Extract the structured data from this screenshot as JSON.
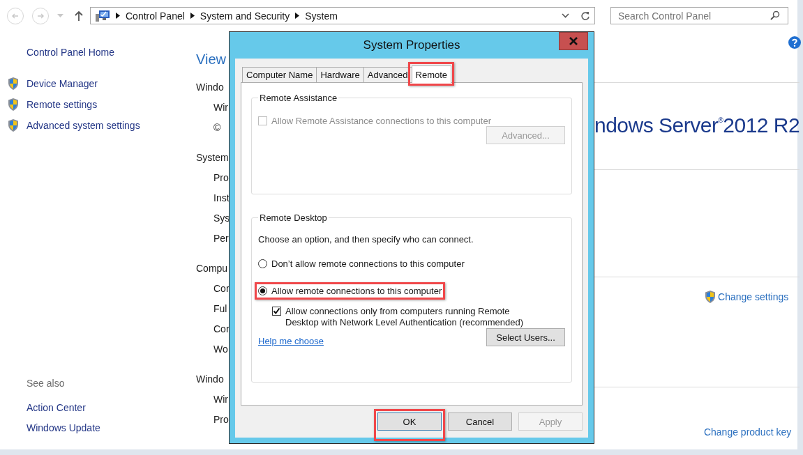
{
  "toolbar": {
    "breadcrumbs": [
      "Control Panel",
      "System and Security",
      "System"
    ],
    "search": {
      "placeholder": "Search Control Panel"
    }
  },
  "sidebar": {
    "items": [
      {
        "label": "Control Panel Home",
        "kind": "home"
      },
      {
        "label": "Device Manager",
        "kind": "shield"
      },
      {
        "label": "Remote settings",
        "kind": "shield"
      },
      {
        "label": "Advanced system settings",
        "kind": "shield"
      }
    ],
    "see_also": {
      "title": "See also",
      "items": [
        "Action Center",
        "Windows Update"
      ]
    }
  },
  "main": {
    "items": [
      {
        "text": "View",
        "kind": "title"
      },
      {
        "text": "Windo",
        "kind": "section"
      },
      {
        "text": "Wir",
        "kind": "item"
      },
      {
        "text": "©",
        "kind": "item"
      },
      {
        "text": "System",
        "kind": "section"
      },
      {
        "text": "Pro",
        "kind": "item"
      },
      {
        "text": "Inst",
        "kind": "item"
      },
      {
        "text": "Sys",
        "kind": "item"
      },
      {
        "text": "Per",
        "kind": "item"
      },
      {
        "text": "Compu",
        "kind": "section"
      },
      {
        "text": "Cor",
        "kind": "item"
      },
      {
        "text": "Ful",
        "kind": "item"
      },
      {
        "text": "Cor",
        "kind": "item"
      },
      {
        "text": "Wo",
        "kind": "item"
      },
      {
        "text": "Windo",
        "kind": "section"
      },
      {
        "text": "Wir",
        "kind": "item"
      },
      {
        "text": "Pro",
        "kind": "item"
      }
    ]
  },
  "right": {
    "logo": "ndows Server$^{®}$2012 R2",
    "change_settings": "Change settings",
    "change_product_key": "Change product key"
  },
  "dialog": {
    "title": "System Properties",
    "tabs": [
      {
        "label": "Computer Name",
        "selected": false,
        "highlighted": false
      },
      {
        "label": "Hardware",
        "selected": false,
        "highlighted": false
      },
      {
        "label": "Advanced",
        "selected": false,
        "highlighted": false
      },
      {
        "label": "Remote",
        "selected": true,
        "highlighted": true
      }
    ],
    "remote_assistance": {
      "title": "Remote Assistance",
      "checkbox": {
        "label": "Allow Remote Assistance connections to this computer",
        "checked": false,
        "disabled": true
      },
      "button": {
        "label": "Advanced...",
        "disabled": true
      }
    },
    "remote_desktop": {
      "title": "Remote Desktop",
      "description": "Choose an option, and then specify who can connect.",
      "options": [
        {
          "label": "Don’t allow remote connections to this computer",
          "selected": false,
          "highlighted": false
        },
        {
          "label": "Allow remote connections to this computer",
          "selected": true,
          "highlighted": true
        }
      ],
      "nla": {
        "label": "Allow connections only from computers running Remote Desktop with Network Level Authentication (recommended)",
        "checked": true,
        "disabled": false
      },
      "help_link": "Help me choose",
      "button": {
        "label": "Select Users...",
        "disabled": false
      }
    },
    "buttons": [
      {
        "label": "OK",
        "disabled": false,
        "highlighted": true
      },
      {
        "label": "Cancel",
        "disabled": false,
        "highlighted": false
      },
      {
        "label": "Apply",
        "disabled": true,
        "highlighted": false
      }
    ]
  }
}
